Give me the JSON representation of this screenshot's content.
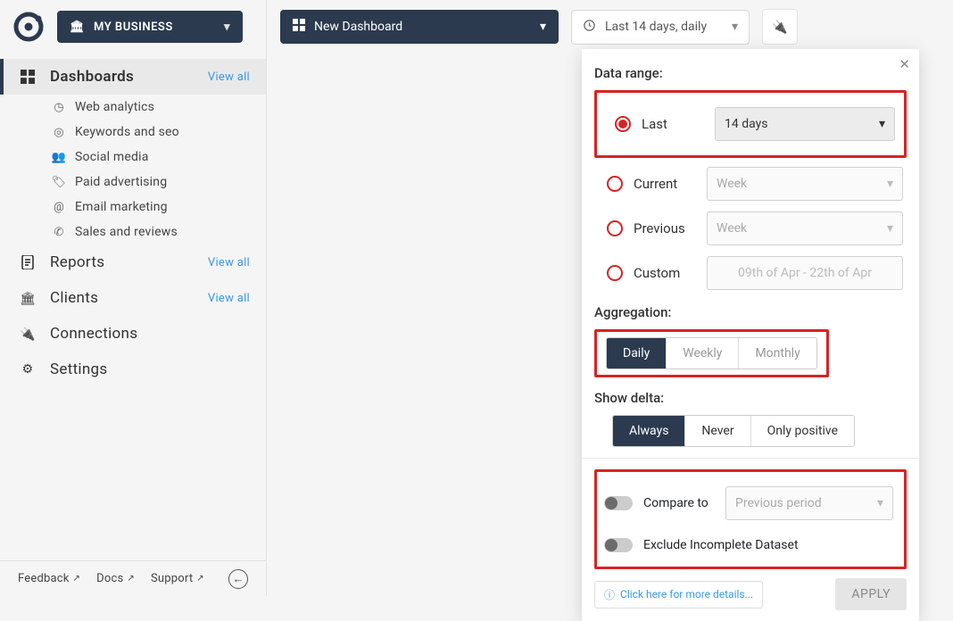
{
  "topbar": {
    "business_label": "MY BUSINESS",
    "dashboard_label": "New Dashboard",
    "date_label": "Last 14 days, daily"
  },
  "sidebar": {
    "dashboards": {
      "label": "Dashboards",
      "view_all": "View all"
    },
    "sub": {
      "web": "Web analytics",
      "keywords": "Keywords and seo",
      "social": "Social media",
      "paid": "Paid advertising",
      "email": "Email marketing",
      "sales": "Sales and reviews"
    },
    "reports": {
      "label": "Reports",
      "view_all": "View all"
    },
    "clients": {
      "label": "Clients",
      "view_all": "View all"
    },
    "connections": {
      "label": "Connections"
    },
    "settings": {
      "label": "Settings"
    }
  },
  "footer": {
    "feedback": "Feedback",
    "docs": "Docs",
    "support": "Support"
  },
  "panel": {
    "data_range_title": "Data range:",
    "options": {
      "last": "Last",
      "current": "Current",
      "previous": "Previous",
      "custom": "Custom"
    },
    "last_value": "14 days",
    "current_value": "Week",
    "previous_value": "Week",
    "custom_value": "09th of Apr - 22th of Apr",
    "aggregation_title": "Aggregation:",
    "agg": {
      "daily": "Daily",
      "weekly": "Weekly",
      "monthly": "Monthly"
    },
    "delta_title": "Show delta:",
    "delta": {
      "always": "Always",
      "never": "Never",
      "positive": "Only positive"
    },
    "compare_label": "Compare to",
    "compare_value": "Previous period",
    "exclude_label": "Exclude Incomplete Dataset",
    "info_link": "Click here for more details...",
    "apply": "APPLY"
  }
}
